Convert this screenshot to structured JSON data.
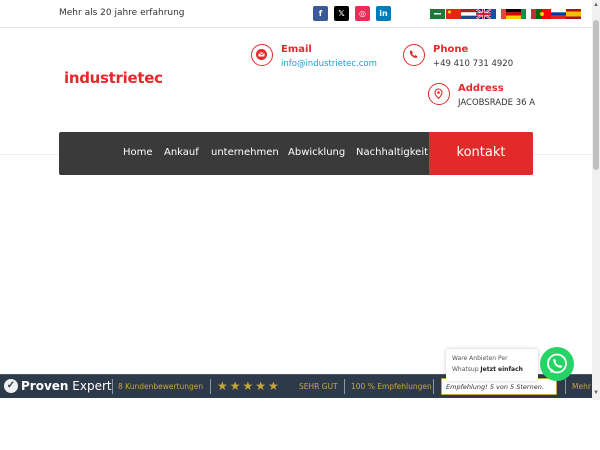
{
  "topbar": {
    "tagline": "Mehr als 20 jahre erfahrung",
    "social": [
      {
        "name": "facebook",
        "glyph": "f"
      },
      {
        "name": "x",
        "glyph": "𝕏"
      },
      {
        "name": "instagram",
        "glyph": "◎"
      },
      {
        "name": "linkedin",
        "glyph": "in"
      }
    ],
    "flags": [
      "ar",
      "zh-CN",
      "nl",
      "en",
      "fr",
      "de",
      "it",
      "pt",
      "ru",
      "es"
    ]
  },
  "header": {
    "logo": "industrietec",
    "email": {
      "title": "Email",
      "value": "info@industrietec.com"
    },
    "phone": {
      "title": "Phone",
      "value": "+49 410 731 4920"
    },
    "address": {
      "title": "Address",
      "value": "JACOBSRADE 36 A"
    }
  },
  "nav": {
    "items": [
      "Home",
      "Ankauf",
      "unternehmen",
      "Abwicklung",
      "Nachhaltigkeit"
    ],
    "cta": "kontakt"
  },
  "provenexpert": {
    "brand_bold": "Proven",
    "brand_light": " Expert",
    "reviews": "8 Kundenbewertungen",
    "rating": "SEHR GUT",
    "recommend": "100 % Empfehlungen",
    "quote": "Empfehlung! 5 von 5 Sternen.",
    "more": "Mehr"
  },
  "whatsapp": {
    "line1": "Ware Anbieten Per",
    "line2_prefix": "Whatsup ",
    "line2_bold": "Jetzt einfach"
  },
  "colors": {
    "accent": "#e32a2a",
    "nav_bg": "#3a3a3a",
    "link": "#1aa0d8",
    "whatsapp": "#25d366",
    "pe_gold": "#c9a638"
  }
}
